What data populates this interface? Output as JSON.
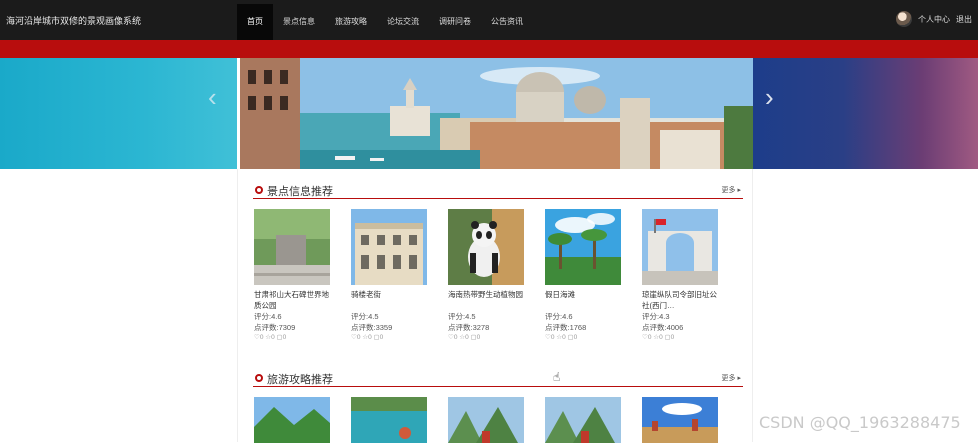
{
  "header": {
    "site_title": "海河沿岸城市双修的景观画像系统",
    "nav": [
      "首页",
      "景点信息",
      "旅游攻略",
      "论坛交流",
      "调研问卷",
      "公告资讯"
    ],
    "active_index": 0,
    "user_center": "个人中心",
    "logout": "退出"
  },
  "banner": {
    "prev_glyph": "‹",
    "next_glyph": "›"
  },
  "sections": {
    "attractions": {
      "title": "景点信息推荐",
      "more": "更多 ▸",
      "cards": [
        {
          "name": "甘肃祁山大石碑世界地质公园",
          "rating": "评分:4.6",
          "reviews": "点评数:7309",
          "stats": "♡0 ☆0 ▢0"
        },
        {
          "name": "骑楼老街",
          "rating": "评分:4.5",
          "reviews": "点评数:3359",
          "stats": "♡0 ☆0 ▢0"
        },
        {
          "name": "海南热带野生动植物园",
          "rating": "评分:4.5",
          "reviews": "点评数:3278",
          "stats": "♡0 ☆0 ▢0"
        },
        {
          "name": "假日海滩",
          "rating": "评分:4.6",
          "reviews": "点评数:1768",
          "stats": "♡0 ☆0 ▢0"
        },
        {
          "name": "琼崖纵队司令部旧址公社(西门…",
          "rating": "评分:4.3",
          "reviews": "点评数:4006",
          "stats": "♡0 ☆0 ▢0"
        }
      ]
    },
    "guides": {
      "title": "旅游攻略推荐",
      "more": "更多 ▸"
    }
  },
  "watermark": "CSDN @QQ_1963288475",
  "colors": {
    "topbar": "#1b1b1b",
    "accent_red": "#b80d0d"
  }
}
